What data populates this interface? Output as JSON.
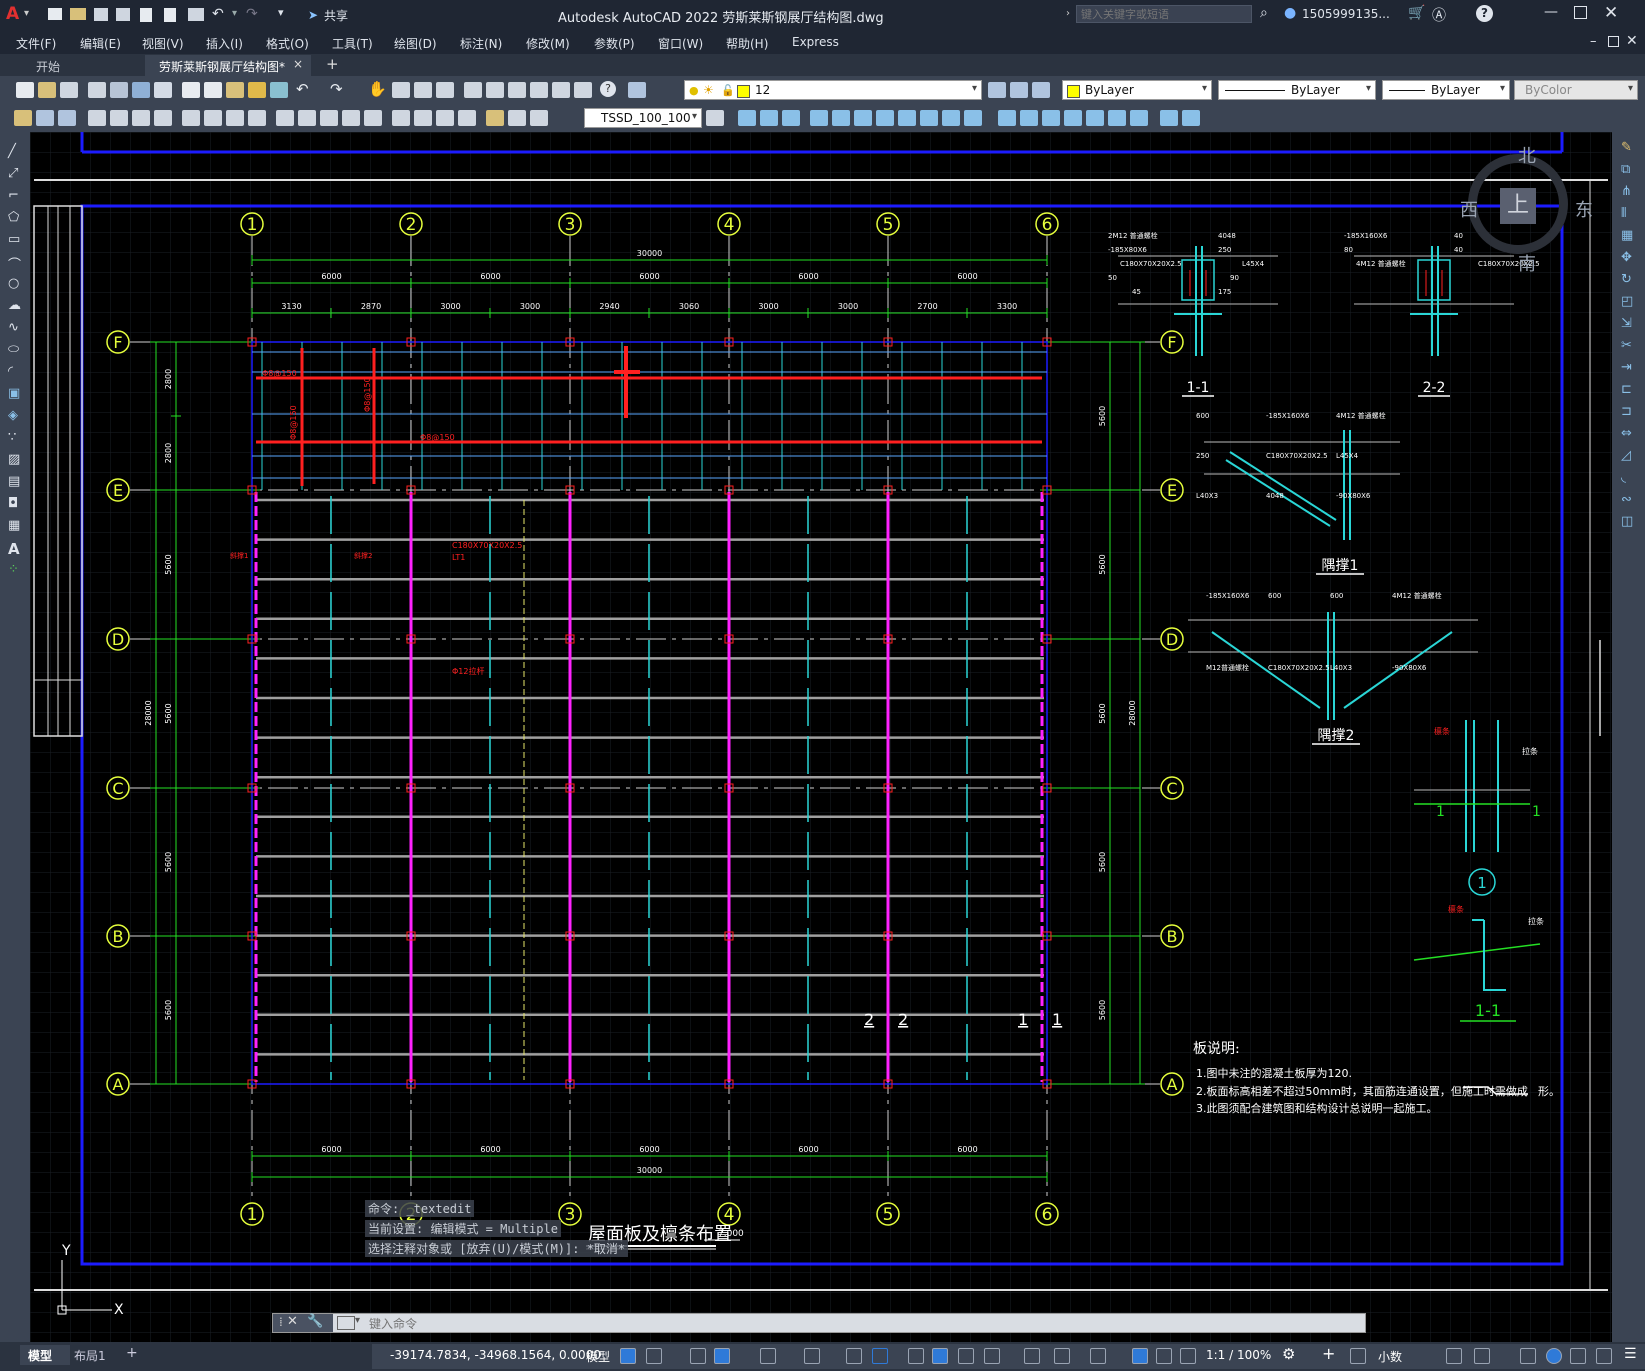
{
  "titlebar": {
    "app_letter": "A",
    "share_label": "共享",
    "title": "Autodesk AutoCAD 2022   劳斯莱斯钢展厅结构图.dwg",
    "search_placeholder": "键入关键字或短语",
    "user": "1505999135...",
    "help": "?"
  },
  "menu": [
    "文件(F)",
    "编辑(E)",
    "视图(V)",
    "插入(I)",
    "格式(O)",
    "工具(T)",
    "绘图(D)",
    "标注(N)",
    "修改(M)",
    "参数(P)",
    "窗口(W)",
    "帮助(H)",
    "Express"
  ],
  "tabs": {
    "start": "开始",
    "active": "劳斯莱斯钢展厅结构图*",
    "close": "×",
    "add": "+"
  },
  "toolbar": {
    "layer_value": "12",
    "color_value": "ByLayer",
    "linetype_value": "ByLayer",
    "lineweight_value": "ByLayer",
    "plotstyle_value": "ByColor",
    "dimstyle_value": "TSSD_100_100"
  },
  "compass": {
    "north": "北",
    "south": "南",
    "west": "西",
    "east": "东",
    "top": "上"
  },
  "drawing": {
    "axes_num": [
      "1",
      "2",
      "3",
      "4",
      "5",
      "6"
    ],
    "axes_letter": [
      "F",
      "E",
      "D",
      "C",
      "B",
      "A"
    ],
    "dim_total_top": "30000",
    "dim_spans": [
      "6000",
      "6000",
      "6000",
      "6000",
      "6000"
    ],
    "dim_sub": [
      "3130",
      "2870",
      "3000",
      "3000",
      "2940",
      "3060",
      "3000",
      "3000",
      "2700",
      "3300"
    ],
    "dim_total_bottom": "30000",
    "dim_left_rows": [
      "2800",
      "2800",
      "5600",
      "5600",
      "5600",
      "5600"
    ],
    "dim_right_rows": [
      "5600",
      "5600",
      "5600",
      "5600",
      "5600"
    ],
    "dim_left_total": "28000",
    "dim_right_total": "28000",
    "plan_title": "屋面板及檩条布置",
    "plan_scale": "7.000",
    "red_labels": [
      "Φ8@150",
      "Φ8@150",
      "Φ8@150",
      "Φ8@150",
      "C180X70X20X2.5",
      "LT1",
      "斜撑1",
      "斜撑2",
      "Φ12拉杆"
    ],
    "section_1_1": "1-1",
    "section_2_2": "2-2",
    "brace1": "隅撑1",
    "brace2": "隅撑2",
    "detail_circle": "1",
    "detail_1_1": "1-1",
    "detail_label_lathe": "拉条",
    "detail_label_purlin": "檩条",
    "sec_marks": [
      "2",
      "2",
      "1",
      "1"
    ],
    "notes_title": "板说明:",
    "notes": [
      "1.图中未注的混凝土板厚为120.",
      "2.板面标高相差不超过50mm时，其面筋连通设置，但施工时需做成",
      "3.此图须配合建筑图和结构设计总说明一起施工。"
    ],
    "notes_suffix": "形。",
    "small_labels": {
      "s11": [
        "2M12 普通螺栓",
        "4048",
        "-185X80X6",
        "250",
        "C180X70X20X2.5",
        "L45X4",
        "50",
        "90",
        "45",
        "175"
      ],
      "s22": [
        "-185X160X6",
        "40",
        "80",
        "40",
        "4M12 普通螺栓",
        "C180X70X20X2.5"
      ],
      "b1": [
        "600",
        "-185X160X6",
        "4M12 普通螺栓",
        "250",
        "C180X70X20X2.5",
        "L45X4",
        "L40X3",
        "4048",
        "-90X80X6"
      ],
      "b2": [
        "-185X160X6",
        "600",
        "600",
        "4M12 普通螺栓",
        "M12普通螺栓",
        "C180X70X20X2.5",
        "L40X3",
        "-90X80X6"
      ]
    }
  },
  "commandline": {
    "history": [
      "命令: _textedit",
      "当前设置: 编辑模式 = Multiple",
      "选择注释对象或 [放弃(U)/模式(M)]: *取消*"
    ],
    "placeholder": "键入命令"
  },
  "statusbar": {
    "tab_model": "模型",
    "tab_layout": "布局1",
    "add": "+",
    "coords": "-39174.7834, -34968.1564, 0.0000",
    "model": "模型",
    "scale": "1:1 / 100%",
    "units": "小数"
  },
  "colors": {
    "axis_yellow": "#e6ff3c",
    "dim_green": "#24e024",
    "rebar_red": "#ff2020",
    "cyan": "#2ad6d6",
    "magenta": "#ff22ff",
    "frame_blue": "#1c1cff"
  }
}
